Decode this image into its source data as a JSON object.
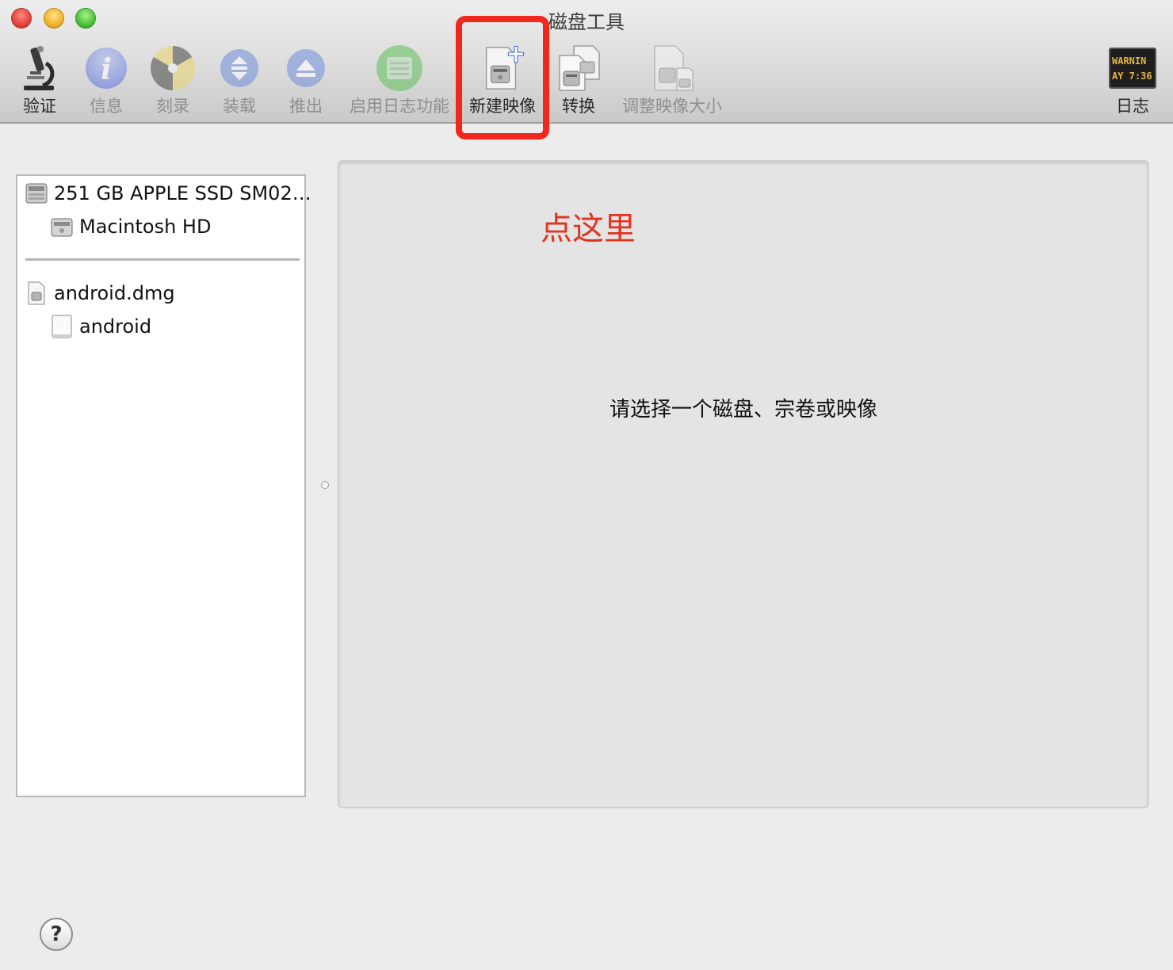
{
  "window": {
    "title": "磁盘工具"
  },
  "toolbar": {
    "items": [
      {
        "label": "验证",
        "icon": "microscope-icon",
        "enabled": true
      },
      {
        "label": "信息",
        "icon": "info-icon",
        "enabled": false
      },
      {
        "label": "刻录",
        "icon": "burn-icon",
        "enabled": false
      },
      {
        "label": "装载",
        "icon": "mount-icon",
        "enabled": false
      },
      {
        "label": "推出",
        "icon": "eject-icon",
        "enabled": false
      },
      {
        "label": "启用日志功能",
        "icon": "journal-icon",
        "enabled": false
      },
      {
        "label": "新建映像",
        "icon": "new-image-icon",
        "enabled": true
      },
      {
        "label": "转换",
        "icon": "convert-icon",
        "enabled": true
      },
      {
        "label": "调整映像大小",
        "icon": "resize-image-icon",
        "enabled": false
      }
    ],
    "log": {
      "label": "日志",
      "icon": "log-console-icon",
      "screen_text_1": "WARNIN",
      "screen_text_2": "AY 7:36"
    }
  },
  "sidebar": {
    "disks": [
      {
        "label": "251 GB APPLE SSD SM02…",
        "icon": "hard-disk-icon"
      },
      {
        "label": "Macintosh HD",
        "icon": "volume-icon"
      }
    ],
    "images": [
      {
        "label": "android.dmg",
        "icon": "dmg-file-icon"
      },
      {
        "label": "android",
        "icon": "mounted-volume-icon"
      }
    ]
  },
  "main": {
    "annotation": "点这里",
    "placeholder": "请选择一个磁盘、宗卷或映像"
  },
  "help": {
    "label": "?"
  },
  "colors": {
    "highlight": "#f0281c",
    "annotation": "#e2331e",
    "panel_bg": "#e4e4e4"
  }
}
